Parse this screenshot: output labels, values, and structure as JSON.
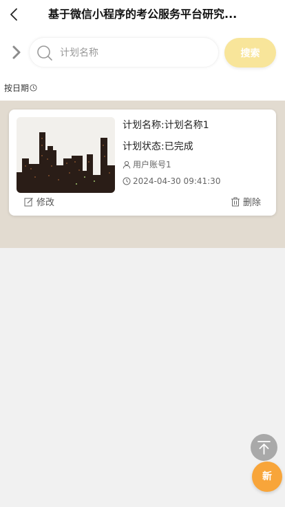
{
  "header": {
    "title": "基于微信小程序的考公服务平台研究...",
    "back_icon": "chevron-left-icon"
  },
  "search": {
    "expand_icon": "chevron-right-icon",
    "search_icon": "search-icon",
    "placeholder": "计划名称",
    "value": "",
    "button_label": "搜索",
    "button_color": "#f8e59a"
  },
  "sort": {
    "label": "按日期",
    "icon": "clock-icon"
  },
  "list": {
    "background_color": "#e2dbd0",
    "items": [
      {
        "name_text": "计划名称:计划名称1",
        "status_text": "计划状态:已完成",
        "user": "用户账号1",
        "time": "2024-04-30 09:41:30",
        "edit_label": "修改",
        "delete_label": "删除",
        "image": "city-skyline-night"
      }
    ]
  },
  "fab": {
    "top_icon": "arrow-to-top-icon",
    "new_label": "新",
    "new_color": "#f8a53a"
  }
}
